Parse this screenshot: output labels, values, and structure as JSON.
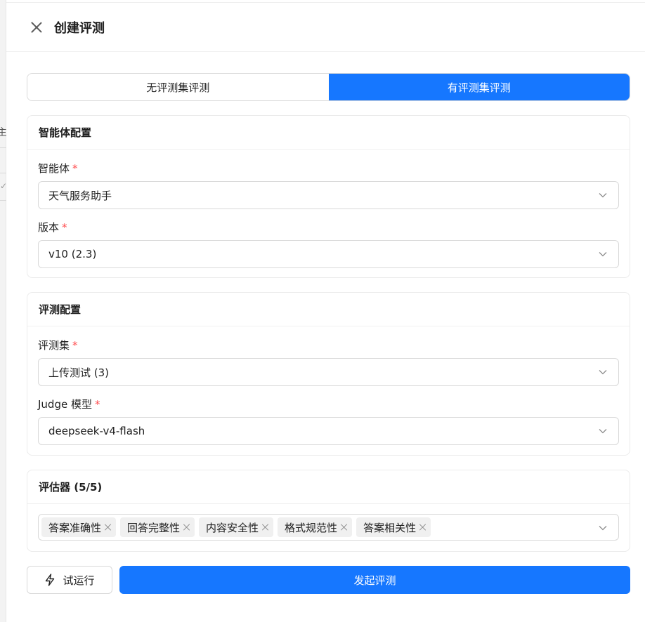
{
  "backdrop": {
    "partial_char": "主"
  },
  "header": {
    "title": "创建评测"
  },
  "mode_tabs": [
    {
      "label": "无评测集评测",
      "active": false
    },
    {
      "label": "有评测集评测",
      "active": true
    }
  ],
  "agent_config": {
    "title": "智能体配置",
    "agent_label": "智能体",
    "agent_value": "天气服务助手",
    "version_label": "版本",
    "version_value": "v10 (2.3)"
  },
  "eval_config": {
    "title": "评测配置",
    "dataset_label": "评测集",
    "dataset_value": "上传测试 (3)",
    "judge_label": "Judge 模型",
    "judge_value": "deepseek-v4-flash"
  },
  "evaluators": {
    "title": "评估器 (5/5)",
    "tags": [
      "答案准确性",
      "回答完整性",
      "内容安全性",
      "格式规范性",
      "答案相关性"
    ]
  },
  "footer": {
    "try_run_label": "试运行",
    "submit_label": "发起评测"
  },
  "colors": {
    "primary": "#1677ff",
    "required": "#ff4d4f",
    "tag_bg": "#f0f0f0"
  },
  "icons": [
    "close-icon",
    "chevron-down-icon",
    "tag-close-icon",
    "bolt-icon"
  ]
}
